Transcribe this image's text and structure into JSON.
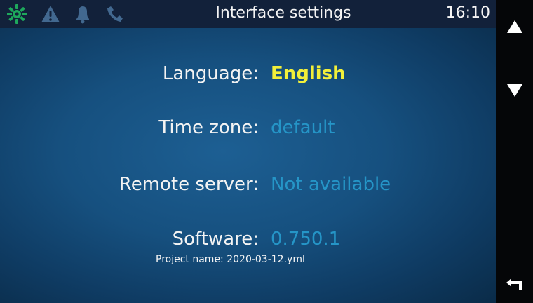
{
  "header": {
    "title": "Interface settings",
    "time": "16:10",
    "status_icons": [
      {
        "name": "gear-icon",
        "color": "#1ea85c"
      },
      {
        "name": "warning-icon",
        "color": "#42688f"
      },
      {
        "name": "bell-icon",
        "color": "#42688f"
      },
      {
        "name": "phone-icon",
        "color": "#42688f"
      }
    ]
  },
  "settings": {
    "language": {
      "label": "Language:",
      "value": "English",
      "color": "#f2f03a"
    },
    "timezone": {
      "label": "Time zone:",
      "value": "default",
      "color": "#2595c7"
    },
    "remote_server": {
      "label": "Remote server:",
      "value": "Not available",
      "color": "#2595c7"
    },
    "software": {
      "label": "Software:",
      "value": "0.750.1",
      "color": "#2595c7",
      "project_name": "Project name: 2020-03-12.yml"
    }
  },
  "navigation": {
    "up_icon": "up-triangle-icon",
    "down_icon": "down-triangle-icon",
    "back_icon": "return-arrow-icon"
  }
}
